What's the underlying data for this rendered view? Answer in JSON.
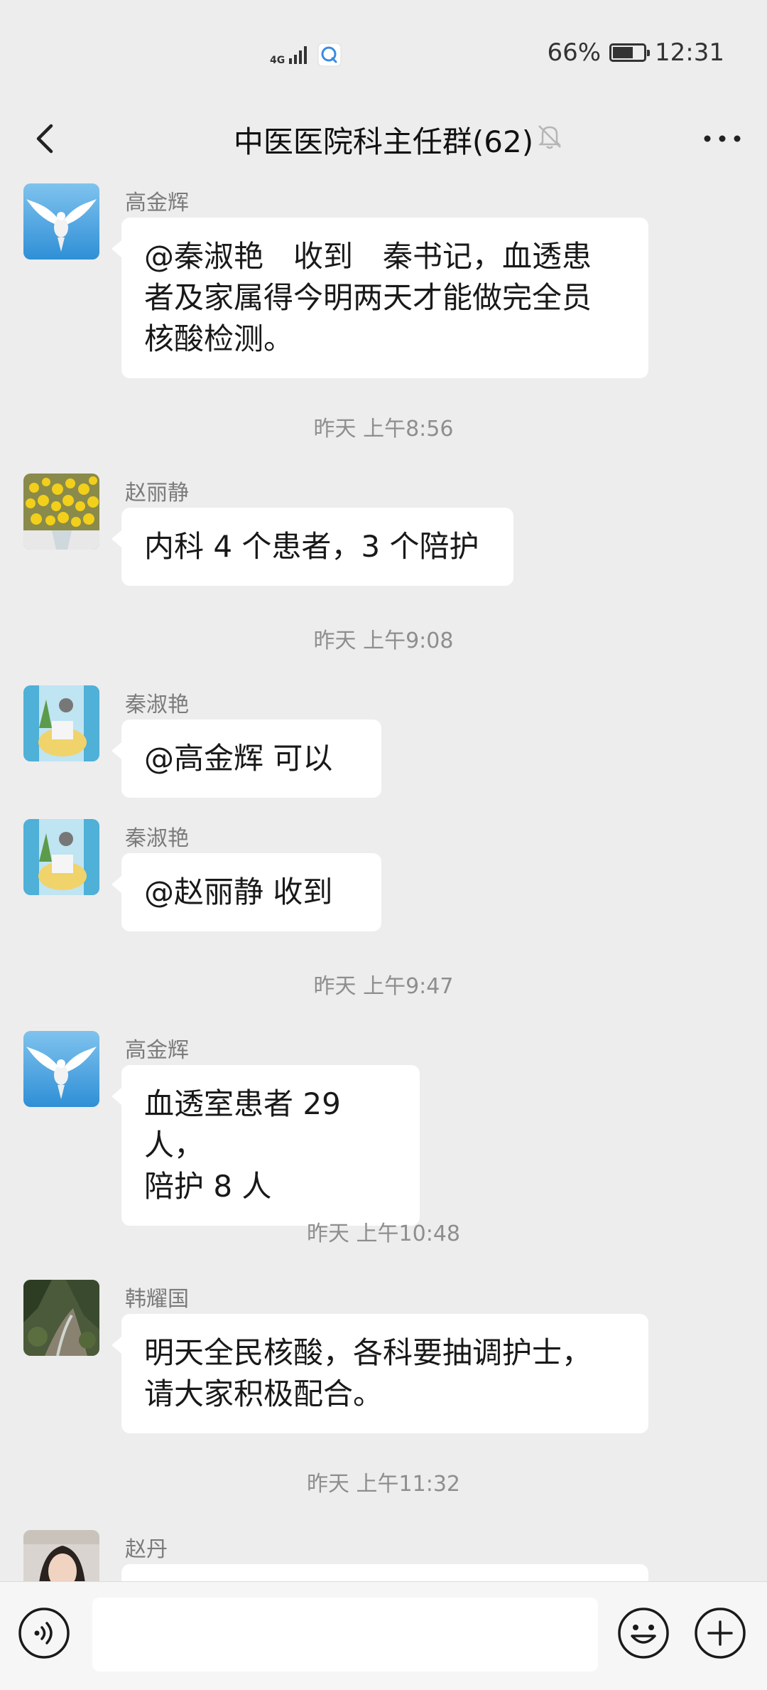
{
  "status_bar": {
    "network": "4G",
    "battery_percent": "66%",
    "battery_level": 0.66,
    "time": "12:31"
  },
  "nav": {
    "title": "中医医院科主任群(62)",
    "back_icon": "chevron-left-icon",
    "mute_icon": "bell-off-icon",
    "more_icon": "more-horizontal-icon"
  },
  "messages": [
    {
      "sender": "高金辉",
      "lines": [
        "@秦淑艳　收到　秦书记，血透患",
        "者及家属得今明两天才能做完全员",
        "核酸检测。"
      ]
    },
    {
      "time": "昨天 上午8:56"
    },
    {
      "sender": "赵丽静",
      "lines": [
        "内科 4 个患者，3 个陪护"
      ]
    },
    {
      "time": "昨天 上午9:08"
    },
    {
      "sender": "秦淑艳",
      "lines": [
        "@高金辉  可以"
      ]
    },
    {
      "sender": "秦淑艳",
      "lines": [
        "@赵丽静  收到"
      ]
    },
    {
      "time": "昨天 上午9:47"
    },
    {
      "sender": "高金辉",
      "lines": [
        "血透室患者 29 人，",
        "陪护 8 人"
      ]
    },
    {
      "time": "昨天 上午10:48"
    },
    {
      "sender": "韩耀国",
      "lines": [
        "明天全民核酸，各科要抽调护士，",
        "请大家积极配合。"
      ]
    },
    {
      "time": "昨天 上午11:32"
    },
    {
      "sender": "赵丹",
      "lines": [
        ""
      ]
    }
  ],
  "input_bar": {
    "voice_icon": "voice-icon",
    "input_value": "",
    "emoji_icon": "emoji-icon",
    "plus_icon": "plus-icon"
  },
  "colors": {
    "background": "#ededed",
    "bubble": "#ffffff",
    "timestamp": "#8e8e8e"
  }
}
